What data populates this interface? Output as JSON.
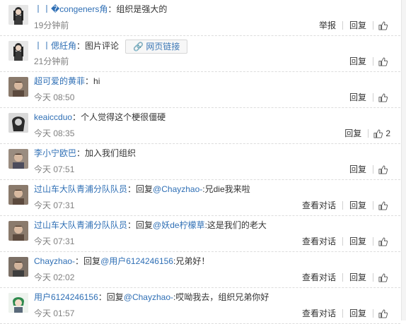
{
  "comments": [
    {
      "user": "丨丨�congeners角",
      "sep": "：",
      "content": "组织是强大的",
      "time": "19分钟前",
      "report": "举报",
      "reply": "回复",
      "likes": ""
    },
    {
      "user": "丨丨偲紝角",
      "sep": "：",
      "content": "图片评论",
      "link_label": "网页链接",
      "time": "21分钟前",
      "reply": "回复",
      "likes": ""
    },
    {
      "user": "超可爱的黄菲",
      "sep": "：",
      "content": "hi",
      "time": "今天 08:50",
      "reply": "回复",
      "likes": ""
    },
    {
      "user": "keaiccduo",
      "sep": "：",
      "content": "个人觉得这个梗很僵硬",
      "time": "今天 08:35",
      "reply": "回复",
      "likes": "2"
    },
    {
      "user": "李小宁欧巴",
      "sep": "：",
      "content": "加入我们组织",
      "time": "今天 07:51",
      "reply": "回复",
      "likes": ""
    },
    {
      "user": "过山车大队青浦分队队员",
      "sep": "：",
      "prefix": "回复",
      "mention": "@Chayzhao-",
      "content": ":兄die我来啦",
      "time": "今天 07:31",
      "view": "查看对话",
      "reply": "回复",
      "likes": ""
    },
    {
      "user": "过山车大队青浦分队队员",
      "sep": "：",
      "prefix": "回复",
      "mention": "@妖de柠檬草",
      "content": ":这是我们的老大",
      "time": "今天 07:31",
      "view": "查看对话",
      "reply": "回复",
      "likes": ""
    },
    {
      "user": "Chayzhao-",
      "sep": "：",
      "prefix": "回复",
      "mention": "@用户6124246156",
      "content": ":兄弟好！",
      "time": "今天 02:02",
      "view": "查看对话",
      "reply": "回复",
      "likes": ""
    },
    {
      "user": "用户6124246156",
      "sep": "：",
      "prefix": "回复",
      "mention": "@Chayzhao-",
      "content": ":哎呦我去，组织兄弟你好",
      "time": "今天 01:57",
      "view": "查看对话",
      "reply": "回复",
      "likes": ""
    }
  ]
}
